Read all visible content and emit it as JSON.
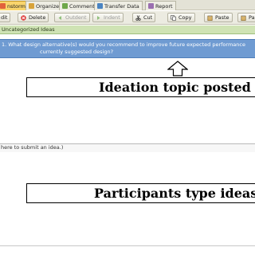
{
  "tabs": [
    {
      "label": "nstorm",
      "icon": "brainstorm-icon",
      "color": "#e2613b",
      "active": true
    },
    {
      "label": "Organize",
      "icon": "organize-icon",
      "color": "#d8a33a",
      "active": false
    },
    {
      "label": "Comment",
      "icon": "comment-icon",
      "color": "#6ea74a",
      "active": false
    },
    {
      "label": "Transfer Data",
      "icon": "transfer-icon",
      "color": "#4a84c2",
      "active": false
    },
    {
      "label": "Report",
      "icon": "report-icon",
      "color": "#9a6fb0",
      "active": false
    }
  ],
  "toolbar": {
    "edit": "dit",
    "delete": "Delete",
    "outdent": "Outdent",
    "indent": "Indent",
    "cut": "Cut",
    "copy": "Copy",
    "paste": "Paste",
    "paste2": "Paste"
  },
  "category_label": "Uncategorized Ideas",
  "topic": {
    "line1": "1. What design alternative(s) would you recommend to improve future expected performance",
    "line2": "currently suggested design?"
  },
  "callouts": {
    "topic": "Ideation topic posted here",
    "ideas": "Participants type ideas here"
  },
  "input_prompt": "here to submit an idea.)"
}
